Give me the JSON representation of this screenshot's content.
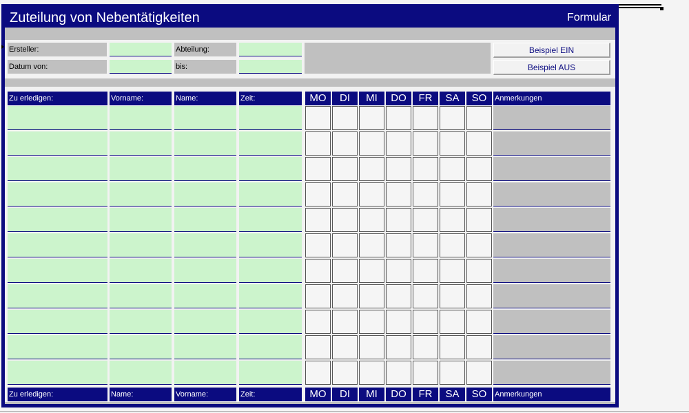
{
  "header": {
    "title": "Zuteilung von Nebentätigkeiten",
    "subtitle": "Formular"
  },
  "form": {
    "ersteller_label": "Ersteller:",
    "datum_von_label": "Datum von:",
    "abteilung_label": "Abteilung:",
    "bis_label": "bis:",
    "ersteller_value": "",
    "datum_von_value": "",
    "abteilung_value": "",
    "bis_value": ""
  },
  "buttons": {
    "beispiel_ein": "Beispiel EIN",
    "beispiel_aus": "Beispiel AUS"
  },
  "table": {
    "top_headers": [
      "Zu erledigen:",
      "Vorname:",
      "Name:",
      "Zeit:"
    ],
    "bottom_headers": [
      "Zu erledigen:",
      "Name:",
      "Vorname:",
      "Zeit:"
    ],
    "days": [
      "MO",
      "DI",
      "MI",
      "DO",
      "FR",
      "SA",
      "SO"
    ],
    "notes_label": "Anmerkungen",
    "row_count": 11
  },
  "colors": {
    "navy": "#0b0b80",
    "input_green": "#ccf4cc",
    "gray": "#c0c0c0"
  }
}
